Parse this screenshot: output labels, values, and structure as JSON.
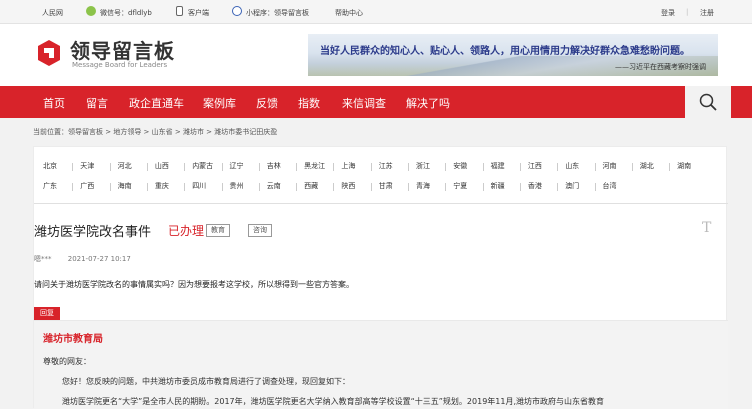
{
  "topbar": {
    "site": "人民网",
    "wechat": "微信号：dfldlyb",
    "client": "客户端",
    "miniapp": "小程序：领导留言板",
    "help": "帮助中心",
    "login": "登录",
    "sep": "|",
    "register": "注册"
  },
  "header": {
    "logo_cn": "领导留言板",
    "logo_en": "Message Board for Leaders",
    "banner_quote": "当好人民群众的知心人、贴心人、领路人，用心用情用力解决好群众急难愁盼问题。",
    "banner_source": "——习近平在西藏考察时强调"
  },
  "nav": {
    "items": [
      "首页",
      "留言",
      "政企直通车",
      "案例库",
      "反馈",
      "指数",
      "来信调查",
      "解决了吗"
    ]
  },
  "breadcrumb": {
    "text": "当前位置：领导留言板 > 地方领导 > 山东省 > 潍坊市 > ",
    "current": "潍坊市委书记田庆盈"
  },
  "regions": {
    "row1": [
      "北京",
      "天津",
      "河北",
      "山西",
      "内蒙古",
      "辽宁",
      "吉林",
      "黑龙江",
      "上海",
      "江苏",
      "浙江",
      "安徽",
      "福建",
      "江西",
      "山东",
      "河南",
      "湖北",
      "湖南"
    ],
    "row2": [
      "广东",
      "广西",
      "海南",
      "重庆",
      "四川",
      "贵州",
      "云南",
      "西藏",
      "陕西",
      "甘肃",
      "青海",
      "宁夏",
      "新疆",
      "香港",
      "澳门",
      "台湾"
    ]
  },
  "message": {
    "title": "潍坊医学院改名事件",
    "status": "已办理",
    "tag1": "教育",
    "tag2": "咨询",
    "font_icon": "T",
    "author": "嗯***",
    "time": "2021-07-27 10:17",
    "question": "请问关于潍坊医学院改名的事情属实吗？因为想要报考这学校，所以想得到一些官方答案。"
  },
  "reply": {
    "badge": "回复",
    "org": "潍坊市教育局",
    "greeting": "尊敬的网友：",
    "line1": "您好！您反映的问题，中共潍坊市委员成市教育局进行了调查处理，现回复如下：",
    "line2": "潍坊医学院更名“大学”是全市人民的期盼。2017年，潍坊医学院更名大学纳入教育部高等学校设置“十三五”规划。2019年11月,潍坊市政府与山东省教育"
  },
  "colors": {
    "brand_red": "#d8232a",
    "banner_text": "#2b3a8a"
  },
  "icons": {
    "search": "search-icon",
    "wechat": "wechat-icon",
    "client": "phone-icon",
    "miniapp": "miniapp-icon",
    "logo": "logo-mark"
  }
}
